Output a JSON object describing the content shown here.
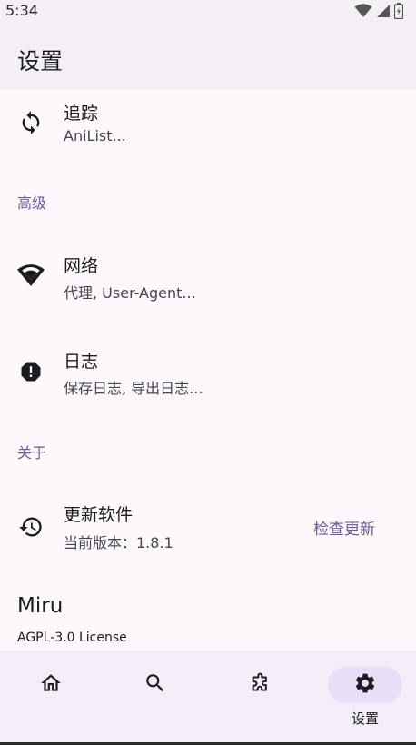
{
  "status_bar": {
    "time": "5:34",
    "icons": [
      "wifi-icon",
      "signal-icon",
      "battery-icon"
    ]
  },
  "app_bar": {
    "title": "设置"
  },
  "settings": {
    "tracking": {
      "title": "追踪",
      "subtitle": "AniList...",
      "icon": "sync-icon"
    },
    "advanced_header": "高级",
    "network": {
      "title": "网络",
      "subtitle": "代理, User-Agent...",
      "icon": "wifi-icon"
    },
    "logs": {
      "title": "日志",
      "subtitle": "保存日志, 导出日志...",
      "icon": "alert-octagon-icon"
    },
    "about_header": "关于",
    "update": {
      "title": "更新软件",
      "subtitle": "当前版本：1.8.1",
      "action": "检查更新",
      "icon": "history-icon"
    }
  },
  "about": {
    "app_name": "Miru",
    "license": "AGPL-3.0 License"
  },
  "nav": {
    "items": [
      {
        "icon": "home-icon",
        "label": ""
      },
      {
        "icon": "search-icon",
        "label": ""
      },
      {
        "icon": "puzzle-icon",
        "label": ""
      },
      {
        "icon": "gear-icon",
        "label": "设置",
        "active": true
      }
    ]
  },
  "colors": {
    "accent": "#6a5a9c",
    "surface": "#fdf8fc",
    "app_bar": "#f3eff4",
    "nav_bar": "#f3edf7",
    "active_pill": "#e8def8"
  }
}
